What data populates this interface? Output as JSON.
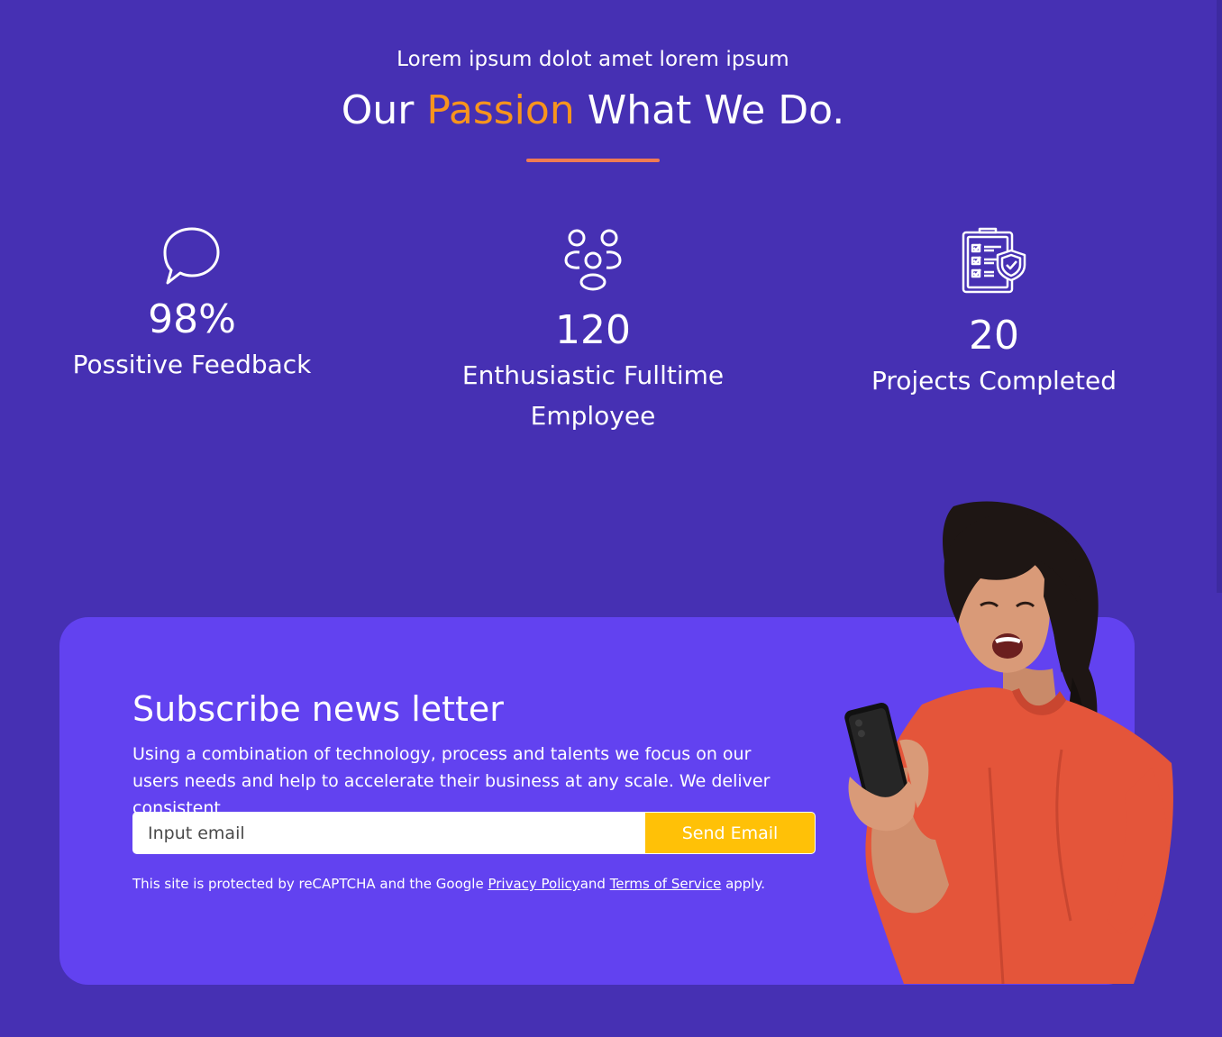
{
  "hero": {
    "kicker": "Lorem ipsum dolot amet lorem ipsum",
    "title_prefix": "Our ",
    "title_accent": "Passion",
    "title_suffix": " What We Do."
  },
  "colors": {
    "background": "#4630b3",
    "card": "#6242f0",
    "accent_orange": "#f7941d",
    "underline": "#f07b52",
    "button": "#ffc107"
  },
  "stats": [
    {
      "icon": "chat-bubble-icon",
      "value": "98%",
      "label": "Possitive Feedback"
    },
    {
      "icon": "people-group-icon",
      "value": "120",
      "label": "Enthusiastic Fulltime Employee"
    },
    {
      "icon": "clipboard-check-icon",
      "value": "20",
      "label": "Projects Completed"
    }
  ],
  "newsletter": {
    "title": "Subscribe news letter",
    "description": "Using a combination of technology, process and talents we focus on our users needs and help to accelerate their business at any scale. We deliver consistent",
    "input_placeholder": "Input email",
    "button_label": "Send Email",
    "legal_prefix": "This site is protected by reCAPTCHA and the Google ",
    "privacy_link": "Privacy Policy",
    "legal_and": "and ",
    "terms_link": "Terms of Service",
    "legal_suffix": " apply."
  },
  "photo": {
    "subject": "woman-with-phone-photo"
  }
}
